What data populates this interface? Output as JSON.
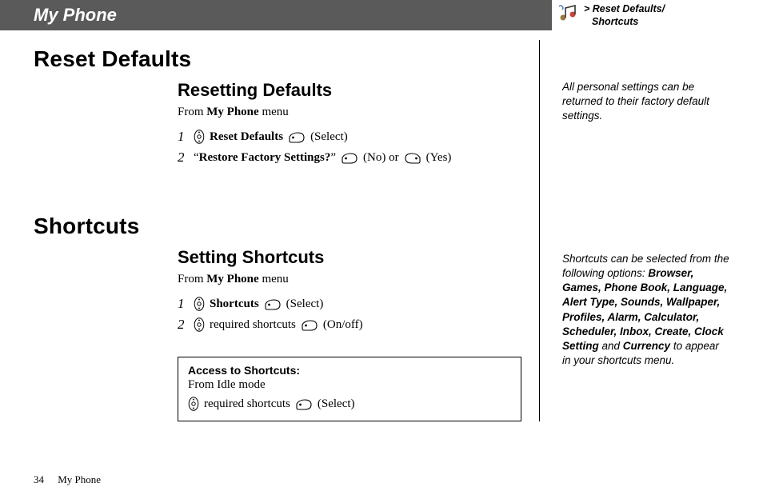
{
  "header": {
    "title": "My Phone",
    "breadcrumb_prefix": "> ",
    "breadcrumb_line1": "Reset Defaults/",
    "breadcrumb_line2": "Shortcuts"
  },
  "section1": {
    "heading": "Reset Defaults",
    "sub": "Resetting Defaults",
    "from_pre": "From ",
    "from_bold": "My Phone",
    "from_post": " menu",
    "step1_num": "1",
    "step1_bold": "Reset Defaults",
    "step1_tail": " (Select)",
    "step2_num": "2",
    "step2_quote_open": "“",
    "step2_bold": "Restore Factory Settings?",
    "step2_quote_close": "” ",
    "step2_no": " (No) or ",
    "step2_yes": " (Yes)"
  },
  "section2": {
    "heading": "Shortcuts",
    "sub": "Setting Shortcuts",
    "from_pre": "From ",
    "from_bold": "My Phone",
    "from_post": " menu",
    "step1_num": "1",
    "step1_bold": "Shortcuts",
    "step1_tail": " (Select)",
    "step2_num": "2",
    "step2_text": " required shortcuts ",
    "step2_tail": " (On/off)"
  },
  "access": {
    "title": "Access to Shortcuts:",
    "line": "From Idle mode",
    "row_text": " required shortcuts ",
    "row_tail": " (Select)"
  },
  "side": {
    "note1": "All personal settings can be returned to their factory default settings.",
    "note2_pre": "Shortcuts can be selected from the following options: ",
    "note2_list": "Browser, Games, Phone Book, Language, Alert Type, Sounds, Wallpaper, Profiles, Alarm, Calculator, Scheduler, Inbox, Create, Clock Setting",
    "note2_and": " and ",
    "note2_last": "Currency",
    "note2_post": " to appear in your shortcuts menu."
  },
  "footer": {
    "page": "34",
    "label": "My Phone"
  }
}
